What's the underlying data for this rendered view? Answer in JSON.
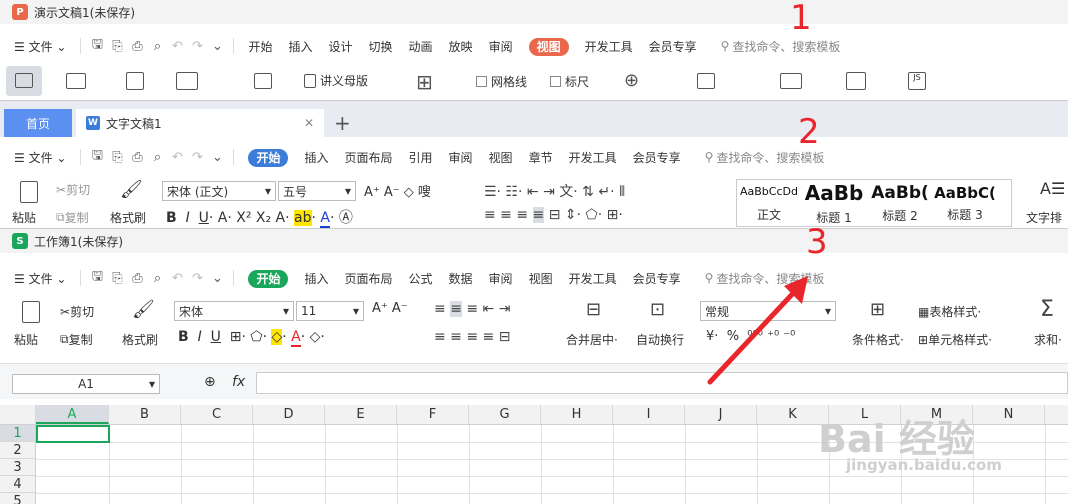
{
  "w1": {
    "title": "演示文稿1(未保存)",
    "icon_letter": "P",
    "file_menu": "文件",
    "menus": [
      "开始",
      "插入",
      "设计",
      "切换",
      "动画",
      "放映",
      "审阅"
    ],
    "active_menu": "视图",
    "menus_after": [
      "开发工具",
      "会员专享"
    ],
    "search": "查找命令、搜索模板",
    "ribbon": {
      "handout": "讲义母版",
      "gridlines": "网格线",
      "ruler": "标尺"
    },
    "accent": "#e9684b"
  },
  "w2": {
    "home_tab": "首页",
    "doc_tab": "文字文稿1",
    "doc_icon": "W",
    "file_menu": "文件",
    "active_menu": "开始",
    "menus": [
      "插入",
      "页面布局",
      "引用",
      "审阅",
      "视图",
      "章节",
      "开发工具",
      "会员专享"
    ],
    "search": "查找命令、搜索模板",
    "ribbon": {
      "paste": "粘贴",
      "cut": "剪切",
      "copy": "复制",
      "format_painter": "格式刷",
      "font": "宋体 (正文)",
      "size": "五号",
      "styles": [
        {
          "sample": "AaBbCcDd",
          "label": "正文"
        },
        {
          "sample": "AaBb",
          "label": "标题 1"
        },
        {
          "sample": "AaBb(",
          "label": "标题 2"
        },
        {
          "sample": "AaBbC(",
          "label": "标题 3"
        }
      ],
      "layout": "文字排版"
    },
    "accent": "#3b7dd8"
  },
  "w3": {
    "title": "工作簿1(未保存)",
    "icon_letter": "S",
    "file_menu": "文件",
    "active_menu": "开始",
    "menus": [
      "插入",
      "页面布局",
      "公式",
      "数据",
      "审阅",
      "视图",
      "开发工具",
      "会员专享"
    ],
    "search": "查找命令、搜索模板",
    "ribbon": {
      "paste": "粘贴",
      "cut": "剪切",
      "copy": "复制",
      "format_painter": "格式刷",
      "font": "宋体",
      "size": "11",
      "merge": "合并居中",
      "wrap": "自动换行",
      "number_format": "常规",
      "currency": "¥",
      "percent": "%",
      "table_style": "表格样式",
      "cond_format": "条件格式",
      "cell_style": "单元格样式",
      "sum": "求和"
    },
    "name_box": "A1",
    "fx": "fx",
    "columns": [
      "A",
      "B",
      "C",
      "D",
      "E",
      "F",
      "G",
      "H",
      "I",
      "J",
      "K",
      "L",
      "M",
      "N"
    ],
    "rows": [
      "1",
      "2",
      "3",
      "4",
      "5"
    ],
    "accent": "#1aa75c"
  },
  "annotations": [
    "1",
    "2",
    "3"
  ],
  "watermark": {
    "brand": "Bai 经验",
    "url": "jingyan.baidu.com"
  },
  "annotation_color": "#e8262b"
}
